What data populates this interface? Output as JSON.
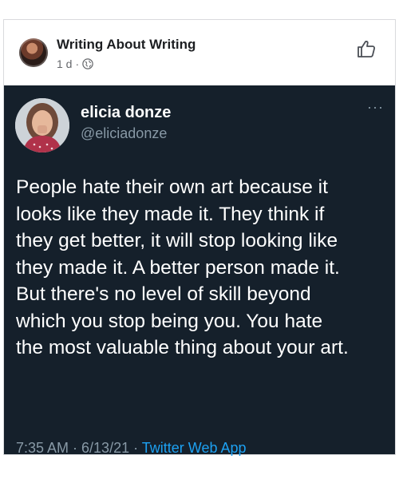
{
  "post": {
    "page_name": "Writing About Writing",
    "time": "1 d",
    "separator": "·",
    "privacy_icon": "globe-icon",
    "action_icon": "like-icon"
  },
  "tweet": {
    "name": "elicia donze",
    "handle": "@eliciadonze",
    "more_icon": "more-icon",
    "more_label": "···",
    "text": "People hate their own art because it\nlooks like they made it. They think if\nthey get better, it will stop looking like\nthey made it. A better person made it.\nBut there's no level of skill beyond\nwhich you stop being you. You hate\nthe most valuable thing about your art.",
    "timestamp": "7:35 AM · 6/13/21 · ",
    "source": "Twitter Web App",
    "colors": {
      "background": "#15202b",
      "secondary_text": "#8899a6",
      "link": "#1da1f2"
    }
  }
}
